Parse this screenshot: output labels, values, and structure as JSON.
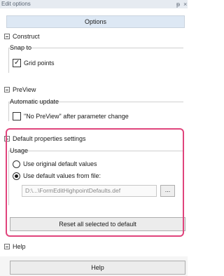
{
  "window": {
    "title": "Edit options",
    "pin_glyph": "ᵽ",
    "close_glyph": "×"
  },
  "header": {
    "label": "Options"
  },
  "construct": {
    "title": "Construct",
    "group_label": "Snap to",
    "checkbox": {
      "label": "Grid points",
      "checked": true
    }
  },
  "preview": {
    "title": "PreView",
    "group_label": "Automatic update",
    "checkbox": {
      "label": "\"No PreView\" after parameter change",
      "checked": false
    }
  },
  "defaults": {
    "title": "Default properties settings",
    "group_label": "Usage",
    "radio_original": {
      "label": "Use original default values",
      "selected": false
    },
    "radio_file": {
      "label": "Use default values from file:",
      "selected": true
    },
    "file_path": "D:\\...\\FormEditHighpointDefaults.def",
    "browse_label": "...",
    "reset_button": "Reset all selected to default"
  },
  "help": {
    "title": "Help",
    "button_label": "Help"
  },
  "colors": {
    "highlight": "#e0447c",
    "header_bg": "#dde8f4"
  }
}
